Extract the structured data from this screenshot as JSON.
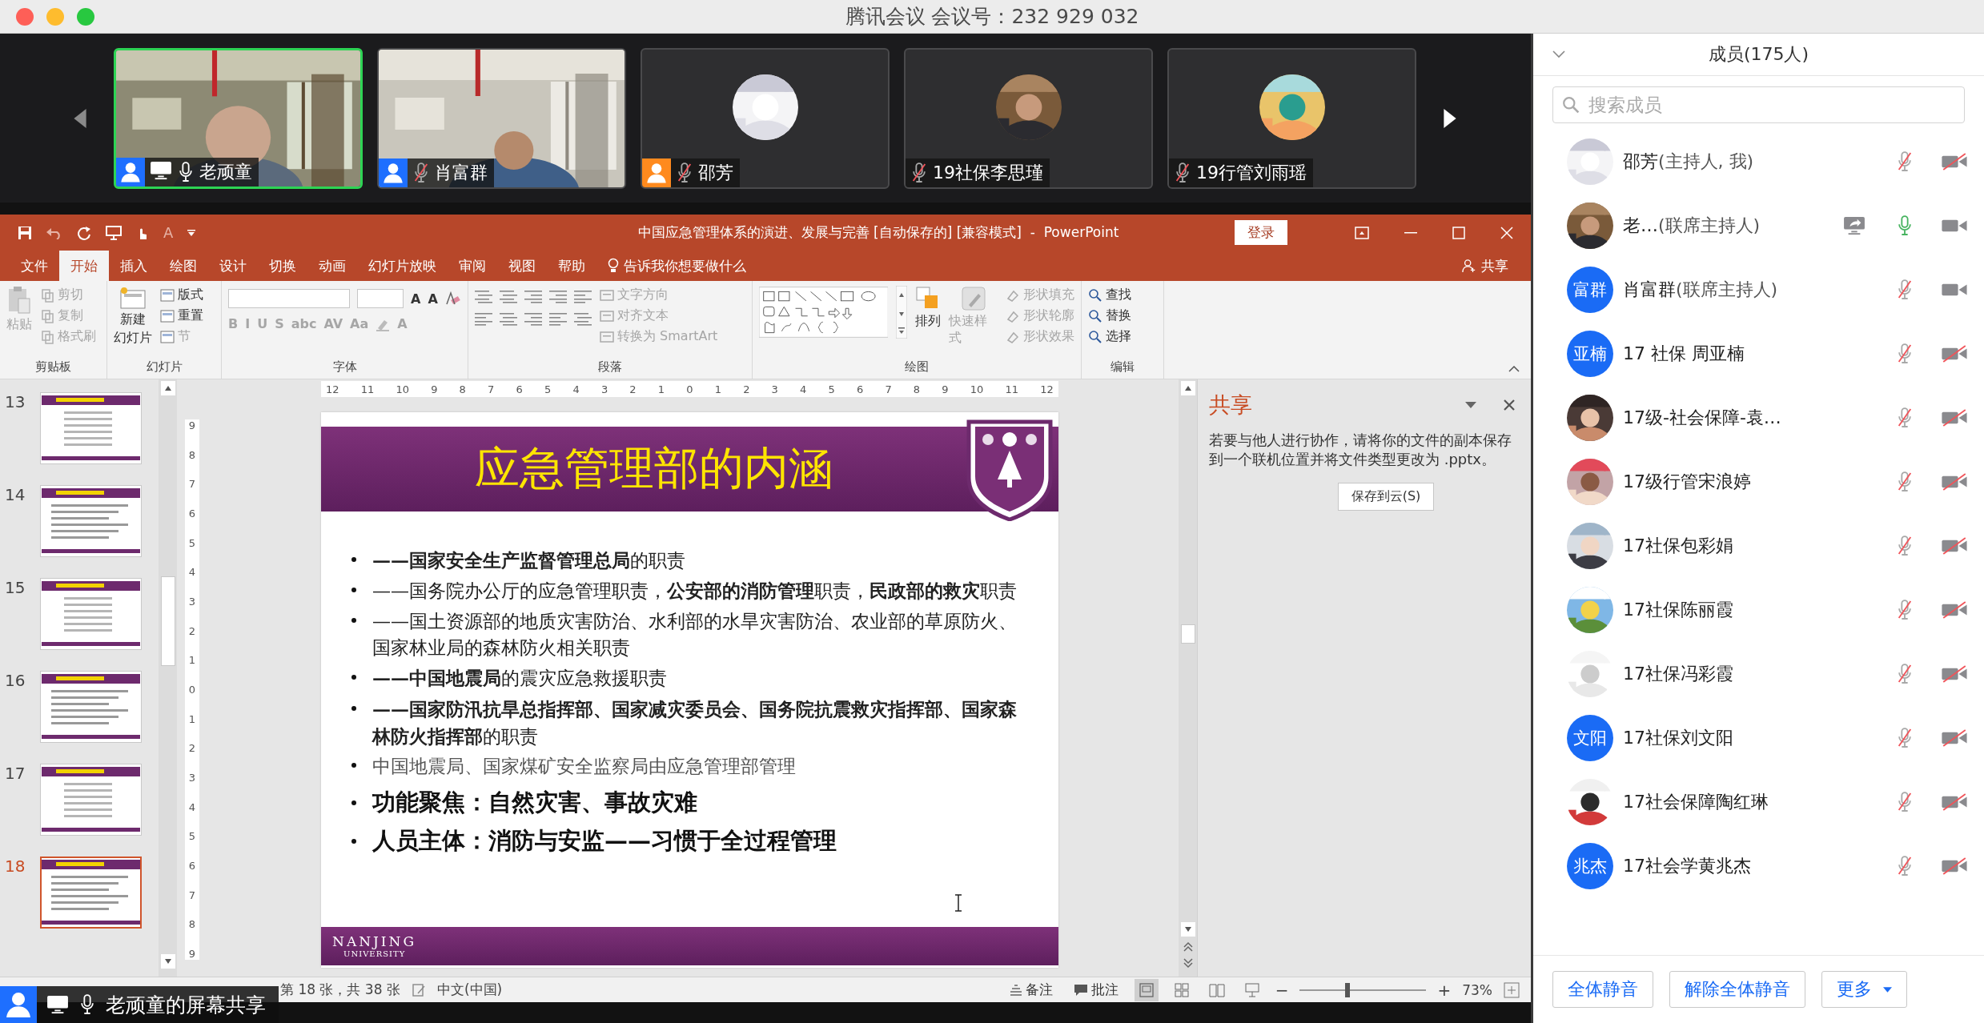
{
  "meeting": {
    "title": "腾讯会议 会议号：232 929 032"
  },
  "video_tiles": [
    {
      "name": "老顽童",
      "kind": "camera",
      "color": "#1e6fff",
      "sharing": true,
      "mic_muted": false,
      "speaking": true
    },
    {
      "name": "肖富群",
      "kind": "camera",
      "color": "#1e6fff",
      "sharing": false,
      "mic_muted": true,
      "speaking": false
    },
    {
      "name": "邵芳",
      "kind": "avatar",
      "color": "#ff8a1e",
      "sharing": false,
      "mic_muted": true,
      "speaking": false
    },
    {
      "name": "19社保李思瑾",
      "kind": "avatar",
      "sharing": false,
      "mic_muted": true,
      "speaking": false
    },
    {
      "name": "19行管刘雨瑶",
      "kind": "avatar",
      "sharing": false,
      "mic_muted": true,
      "speaking": false
    }
  ],
  "powerpoint": {
    "title": "中国应急管理体系的演进、发展与完善 [自动保存的] [兼容模式]  -  PowerPoint",
    "quick_glyph": "A",
    "login": "登录",
    "tabs": [
      {
        "label": "文件",
        "selected": false
      },
      {
        "label": "开始",
        "selected": true
      },
      {
        "label": "插入",
        "selected": false
      },
      {
        "label": "绘图",
        "selected": false
      },
      {
        "label": "设计",
        "selected": false
      },
      {
        "label": "切换",
        "selected": false
      },
      {
        "label": "动画",
        "selected": false
      },
      {
        "label": "幻灯片放映",
        "selected": false
      },
      {
        "label": "审阅",
        "selected": false
      },
      {
        "label": "视图",
        "selected": false
      },
      {
        "label": "帮助",
        "selected": false
      }
    ],
    "tell_me": "告诉我你想要做什么",
    "share": "共享",
    "ribbon": {
      "clipboard": {
        "label": "剪贴板",
        "paste": {
          "label": "粘贴",
          "disabled": true
        },
        "cut": {
          "label": "剪切",
          "disabled": true
        },
        "copy": {
          "label": "复制",
          "disabled": true
        },
        "format_painter": {
          "label": "格式刷",
          "disabled": true
        }
      },
      "slides": {
        "label": "幻灯片",
        "new_slide": {
          "lines": [
            "新建",
            "幻灯片"
          ],
          "disabled": false
        },
        "layout": {
          "label": "版式",
          "disabled": false
        },
        "reset": {
          "label": "重置",
          "disabled": false
        },
        "section": {
          "label": "节",
          "disabled": true
        }
      },
      "font": {
        "label": "字体",
        "size_glyphs": [
          "A",
          "A"
        ],
        "style_glyphs": [
          "B",
          "I",
          "U",
          "S",
          "abc",
          "AV",
          "Aa"
        ],
        "color_glyph": "A",
        "disabled": true
      },
      "paragraph": {
        "label": "段落",
        "text_direction": {
          "label": "文字方向",
          "disabled": true
        },
        "align_text": {
          "label": "对齐文本",
          "disabled": true
        },
        "smartart": {
          "label": "转换为 SmartArt",
          "disabled": true
        }
      },
      "drawing": {
        "label": "绘图",
        "arrange": {
          "label": "排列",
          "disabled": false
        },
        "quick_styles": {
          "label": "快速样式",
          "disabled": true
        },
        "fill": {
          "label": "形状填充",
          "disabled": true
        },
        "outline": {
          "label": "形状轮廓",
          "disabled": true
        },
        "effects": {
          "label": "形状效果",
          "disabled": true
        }
      },
      "editing": {
        "label": "编辑",
        "find": {
          "label": "查找",
          "disabled": false
        },
        "replace": {
          "label": "替换",
          "disabled": false
        },
        "select": {
          "label": "选择",
          "disabled": false
        }
      }
    },
    "thumbnails": [
      {
        "number": "13",
        "selected": false
      },
      {
        "number": "14",
        "selected": false
      },
      {
        "number": "15",
        "selected": false
      },
      {
        "number": "16",
        "selected": false
      },
      {
        "number": "17",
        "selected": false
      },
      {
        "number": "18",
        "selected": true
      }
    ],
    "top_ruler": [
      "12",
      "11",
      "10",
      "9",
      "8",
      "7",
      "6",
      "5",
      "4",
      "3",
      "2",
      "1",
      "0",
      "1",
      "2",
      "3",
      "4",
      "5",
      "6",
      "7",
      "8",
      "9",
      "10",
      "11",
      "12"
    ],
    "left_ruler": [
      "9",
      "8",
      "7",
      "6",
      "5",
      "4",
      "3",
      "2",
      "1",
      "0",
      "1",
      "2",
      "3",
      "4",
      "5",
      "6",
      "7",
      "8",
      "9"
    ],
    "slide": {
      "title": "应急管理部的内涵",
      "bullets": [
        {
          "kind": "item",
          "text": "**——国家安全生产监督管理总局**的职责"
        },
        {
          "kind": "item",
          "text": "——国务院办公厅的应急管理职责，**公安部的消防管理**职责，**民政部的救灾**职责"
        },
        {
          "kind": "item",
          "text": "——国土资源部的地质灾害防治、水利部的水旱灾害防治、农业部的草原防火、国家林业局的森林防火相关职责"
        },
        {
          "kind": "item",
          "text": "**——中国地震局**的震灾应急救援职责"
        },
        {
          "kind": "item",
          "text": "**——国家防汛抗旱总指挥部、国家减灾委员会、国务院抗震救灾指挥部、国家森林防火指挥部**的职责"
        },
        {
          "kind": "note",
          "text": "中国地震局、国家煤矿安全监察局由应急管理部管理"
        },
        {
          "kind": "key",
          "text": "功能聚焦：自然灾害、事故灾难"
        },
        {
          "kind": "key",
          "text": "人员主体：消防与安监——习惯于全过程管理"
        }
      ],
      "footer": {
        "name": "NANJING",
        "sub": "UNIVERSITY"
      }
    },
    "share_pane": {
      "title": "共享",
      "description": "若要与他人进行协作，请将你的文件的副本保存到一个联机位置并将文件类型更改为 .pptx。",
      "button": "保存到云(S)"
    },
    "status_bar": {
      "slide_count": "第 18 张，共 38 张",
      "language": "中文(中国)",
      "notes": "备注",
      "comments": "批注",
      "zoom_out": "−",
      "zoom_in": "+",
      "zoom": {
        "level": 0.36
      },
      "zoom_text": "73%"
    }
  },
  "screen_share": {
    "label": "老顽童的屏幕共享"
  },
  "members": {
    "title": "成员(175人)",
    "search": {
      "placeholder": "搜索成员"
    },
    "rows": [
      {
        "name": "邵芳",
        "role": "(主持人, 我)",
        "sharing": false,
        "mic_muted": true,
        "camera_on": false
      },
      {
        "name": "老…",
        "role": "(联席主持人)",
        "sharing": true,
        "mic_muted": false,
        "camera_on": true
      },
      {
        "name": "肖富群",
        "role": "(联席主持人)",
        "avatar": {
          "kind": "initials",
          "text": "富群"
        },
        "sharing": false,
        "mic_muted": true,
        "camera_on": true
      },
      {
        "name": "17 社保 周亚楠",
        "avatar": {
          "kind": "initials",
          "text": "亚楠"
        },
        "sharing": false,
        "mic_muted": true,
        "camera_on": false
      },
      {
        "name": "17级-社会保障-袁…",
        "sharing": false,
        "mic_muted": true,
        "camera_on": false
      },
      {
        "name": "17级行管宋浪婷",
        "sharing": false,
        "mic_muted": true,
        "camera_on": false
      },
      {
        "name": "17社保包彩娟",
        "sharing": false,
        "mic_muted": true,
        "camera_on": false
      },
      {
        "name": "17社保陈丽霞",
        "sharing": false,
        "mic_muted": true,
        "camera_on": false
      },
      {
        "name": "17社保冯彩霞",
        "sharing": false,
        "mic_muted": true,
        "camera_on": false
      },
      {
        "name": "17社保刘文阳",
        "avatar": {
          "kind": "initials",
          "text": "文阳"
        },
        "sharing": false,
        "mic_muted": true,
        "camera_on": false
      },
      {
        "name": "17社会保障陶红琳",
        "sharing": false,
        "mic_muted": true,
        "camera_on": false
      },
      {
        "name": "17社会学黄兆杰",
        "avatar": {
          "kind": "initials",
          "text": "兆杰"
        },
        "sharing": false,
        "mic_muted": true,
        "camera_on": false
      }
    ],
    "buttons": [
      "全体静音",
      "解除全体静音",
      "更多"
    ]
  }
}
